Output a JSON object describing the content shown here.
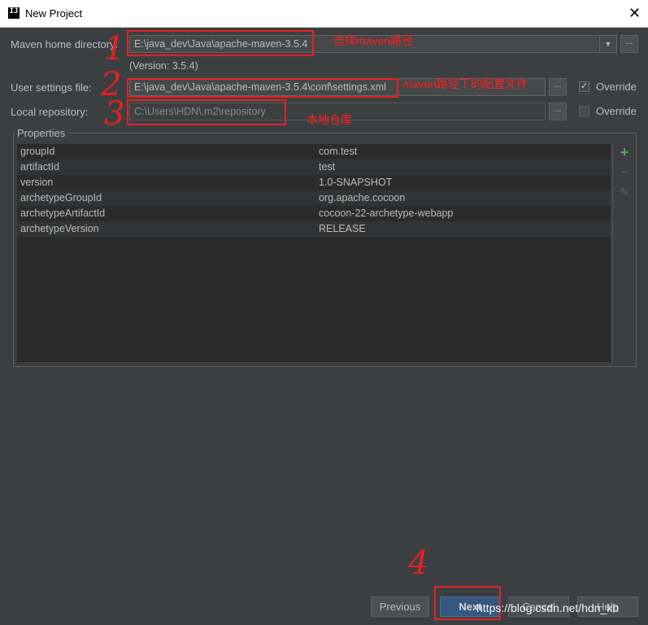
{
  "window": {
    "title": "New Project",
    "icon": "intellij-idea-icon"
  },
  "maven_home": {
    "label": "Maven home directory:",
    "value": "E:\\java_dev\\Java\\apache-maven-3.5.4",
    "version": "(Version: 3.5.4)"
  },
  "user_settings": {
    "label": "User settings file:",
    "value": "E:\\java_dev\\Java\\apache-maven-3.5.4\\conf\\settings.xml",
    "override_label": "Override",
    "override_checked": true
  },
  "local_repo": {
    "label": "Local repository:",
    "value": "C:\\Users\\HDN\\.m2\\repository",
    "override_label": "Override",
    "override_checked": false
  },
  "browse_label": "...",
  "properties": {
    "title": "Properties",
    "rows": [
      {
        "key": "groupId",
        "value": "com.test"
      },
      {
        "key": "artifactId",
        "value": "test"
      },
      {
        "key": "version",
        "value": "1.0-SNAPSHOT"
      },
      {
        "key": "archetypeGroupId",
        "value": "org.apache.cocoon"
      },
      {
        "key": "archetypeArtifactId",
        "value": "cocoon-22-archetype-webapp"
      },
      {
        "key": "archetypeVersion",
        "value": "RELEASE"
      }
    ],
    "toolbar": {
      "add": "+",
      "remove": "−",
      "edit": "✎"
    }
  },
  "buttons": {
    "previous": "Previous",
    "next": "Next",
    "cancel": "Cancel",
    "help": "Help"
  },
  "annotations": {
    "num1": "1",
    "num2": "2",
    "num3": "3",
    "num4": "4",
    "text1": "选择maven路径",
    "text2": "maven路径下的配置文件",
    "text3": "本地仓库"
  },
  "watermark": "https://blog.csdn.net/hdn_kb",
  "colors": {
    "background": "#3c3f41",
    "annotation": "#e52222",
    "default_button": "#365880"
  }
}
